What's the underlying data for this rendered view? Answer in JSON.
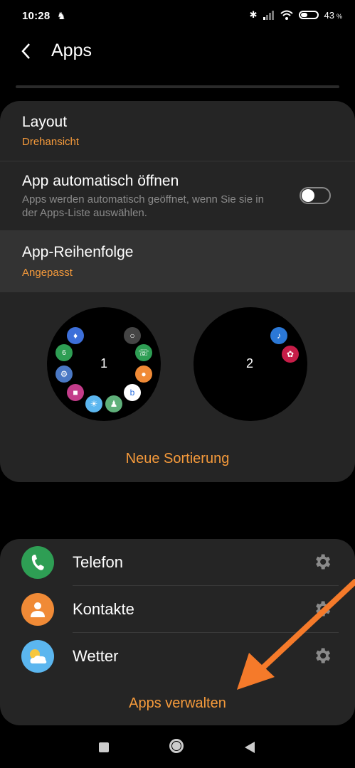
{
  "status_bar": {
    "time": "10:28",
    "battery": "43",
    "battery_unit": "%",
    "battery_level": 0.43
  },
  "header": {
    "title": "Apps"
  },
  "settings": {
    "layout": {
      "title": "Layout",
      "value": "Drehansicht"
    },
    "auto_open": {
      "title": "App automatisch öffnen",
      "description": "Apps werden automatisch geöffnet, wenn Sie sie in der Apps-Liste auswählen.",
      "enabled": false
    },
    "order": {
      "title": "App-Reihenfolge",
      "value": "Angepasst"
    }
  },
  "pages": [
    {
      "number": "1"
    },
    {
      "number": "2"
    }
  ],
  "reorder_label": "Neue Sortierung",
  "apps": [
    {
      "name": "Telefon",
      "icon": "phone-icon",
      "color": "#2e9e54"
    },
    {
      "name": "Kontakte",
      "icon": "contact-icon",
      "color": "#f08a36"
    },
    {
      "name": "Wetter",
      "icon": "weather-icon",
      "color": "#5bb6ef"
    }
  ],
  "manage_label": "Apps verwalten",
  "colors": {
    "accent": "#f59a3b",
    "card": "#252525",
    "annotation_arrow": "#f57a2a"
  }
}
